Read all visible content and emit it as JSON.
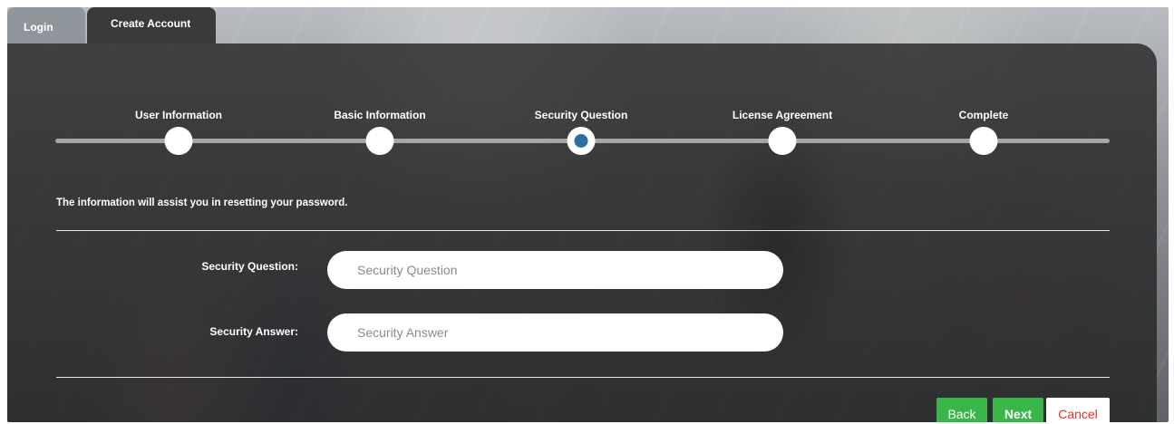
{
  "tabs": {
    "login": "Login",
    "create_account": "Create Account"
  },
  "steps": [
    {
      "label": "User Information",
      "active": false
    },
    {
      "label": "Basic Information",
      "active": false
    },
    {
      "label": "Security Question",
      "active": true
    },
    {
      "label": "License Agreement",
      "active": false
    },
    {
      "label": "Complete",
      "active": false
    }
  ],
  "info_text": "The information will assist you in resetting your password.",
  "form": {
    "security_question": {
      "label": "Security Question:",
      "value": "",
      "placeholder": "Security Question"
    },
    "security_answer": {
      "label": "Security Answer:",
      "value": "",
      "placeholder": "Security Answer"
    }
  },
  "buttons": {
    "back": "Back",
    "next": "Next",
    "cancel": "Cancel"
  },
  "colors": {
    "active_step": "#2d6da0",
    "primary_button": "#3ab54a",
    "cancel_text": "#d9372c"
  }
}
